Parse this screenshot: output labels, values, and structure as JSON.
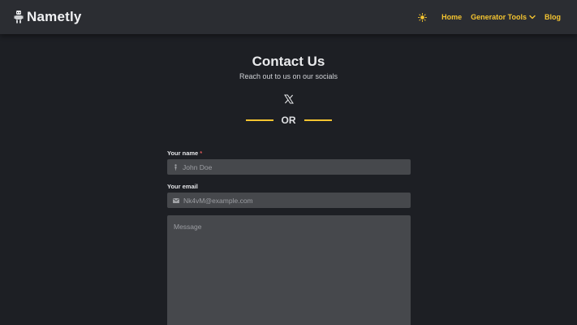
{
  "brand": {
    "name": "Nametly",
    "icon": "robot-icon"
  },
  "nav": {
    "theme_icon": "sun-icon",
    "home": "Home",
    "generator_tools": "Generator Tools",
    "blog": "Blog"
  },
  "page": {
    "title": "Contact Us",
    "subtitle": "Reach out to us on our socials",
    "social_icon": "x-logo-icon",
    "divider_text": "OR"
  },
  "form": {
    "name_label": "Your name",
    "name_required": "*",
    "name_placeholder": "John Doe",
    "email_label": "Your email",
    "email_placeholder": "Nk4vM@example.com",
    "message_placeholder": "Message"
  },
  "colors": {
    "accent": "#f4c430",
    "background": "#1d1f24",
    "navbar": "#2b2d32",
    "input": "#46484c"
  }
}
